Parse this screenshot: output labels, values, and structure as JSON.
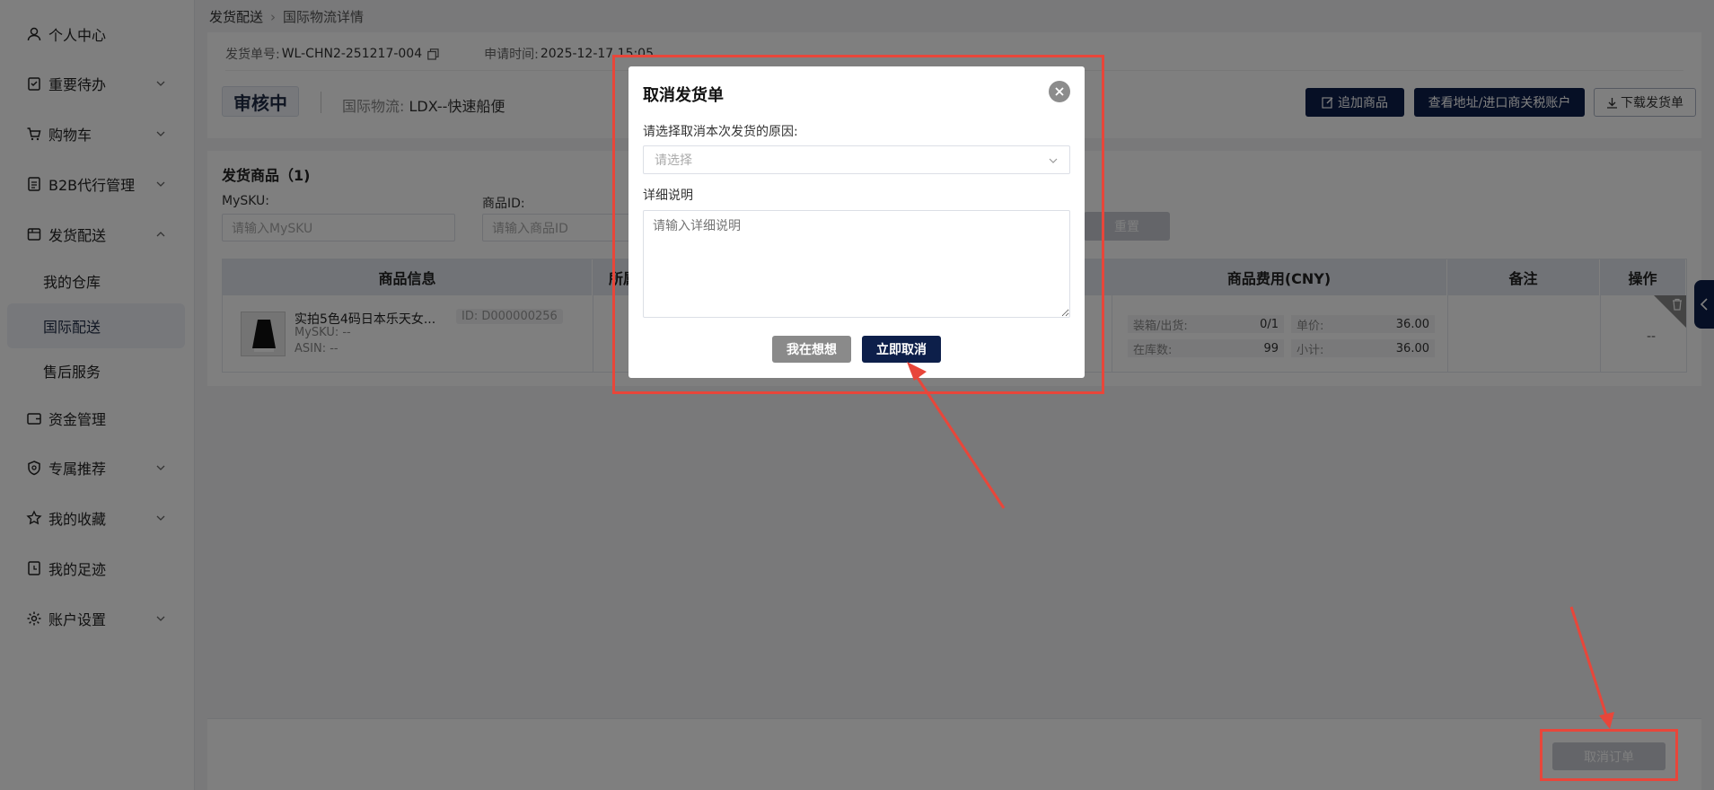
{
  "sidebar": {
    "items": [
      {
        "label": "个人中心",
        "icon": "user-icon",
        "chevron": false
      },
      {
        "label": "重要待办",
        "icon": "clipboard-icon",
        "chevron": true
      },
      {
        "label": "购物车",
        "icon": "cart-icon",
        "chevron": true
      },
      {
        "label": "B2B代行管理",
        "icon": "document-icon",
        "chevron": true
      },
      {
        "label": "发货配送",
        "icon": "box-icon",
        "chevron": true,
        "expanded": true
      },
      {
        "label": "资金管理",
        "icon": "wallet-icon",
        "chevron": false
      },
      {
        "label": "专属推荐",
        "icon": "shield-star-icon",
        "chevron": true
      },
      {
        "label": "我的收藏",
        "icon": "star-icon",
        "chevron": true
      },
      {
        "label": "我的足迹",
        "icon": "footprint-icon",
        "chevron": false
      },
      {
        "label": "账户设置",
        "icon": "gear-icon",
        "chevron": true
      }
    ],
    "sub_items": [
      {
        "label": "我的仓库",
        "active": false
      },
      {
        "label": "国际配送",
        "active": true
      },
      {
        "label": "售后服务",
        "active": false
      }
    ]
  },
  "breadcrumb": {
    "parent": "发货配送",
    "current": "国际物流详情"
  },
  "order": {
    "number_label": "发货单号:",
    "number": "WL-CHN2-251217-004",
    "time_label": "申请时间:",
    "time": "2025-12-17 15:05",
    "status": "审核中",
    "logistics_label": "国际物流:",
    "logistics_value": "LDX--快速船便"
  },
  "toolbar": {
    "add_goods": "追加商品",
    "view_address": "查看地址/进口商关税账户",
    "download": "下载发货单"
  },
  "goods": {
    "title": "发货商品（1)",
    "filter": {
      "mysku_label": "MySKU:",
      "mysku_placeholder": "请输入MySKU",
      "id_label": "商品ID:",
      "id_placeholder": "请输入商品ID",
      "reset": "重置"
    },
    "columns": {
      "info": "商品信息",
      "partial": "所属",
      "fee": "商品费用(CNY)",
      "remark": "备注",
      "op": "操作"
    },
    "row": {
      "name": "实拍5色4码日本乐天女...",
      "id": "ID: D000000256",
      "mysku": "MySKU: --",
      "asin": "ASIN: --",
      "pack_label": "装箱/出货:",
      "pack_value": "0/1",
      "stock_label": "在库数:",
      "stock_value": "99",
      "price_label": "单价:",
      "price_value": "36.00",
      "subtotal_label": "小计:",
      "subtotal_value": "36.00",
      "op": "--"
    }
  },
  "footer": {
    "cancel_order": "取消订单"
  },
  "modal": {
    "title": "取消发货单",
    "reason_label": "请选择取消本次发货的原因:",
    "reason_placeholder": "请选择",
    "detail_label": "详细说明",
    "detail_placeholder": "请输入详细说明",
    "think_button": "我在想想",
    "confirm_button": "立即取消"
  },
  "colors": {
    "primary": "#0d1f4a",
    "annotation": "#e8463a"
  }
}
